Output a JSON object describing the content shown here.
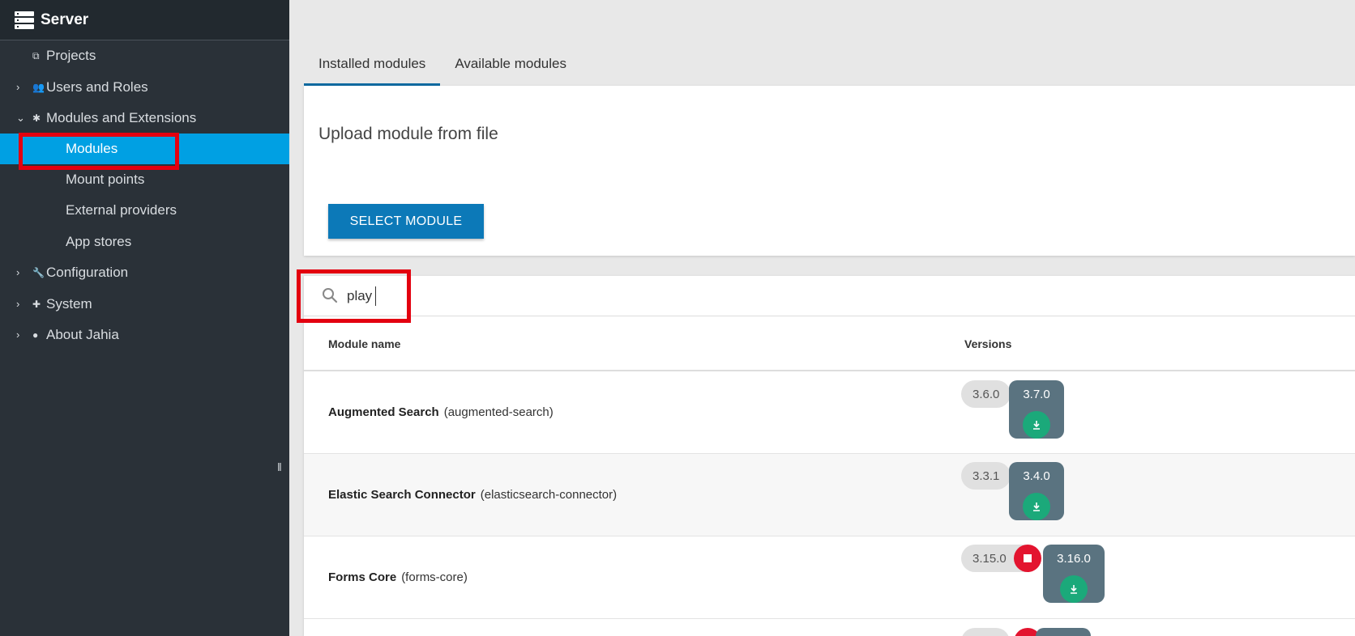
{
  "sidebar": {
    "title": "Server",
    "items": [
      {
        "label": "Projects",
        "icon": "projects-icon",
        "chevron": ""
      },
      {
        "label": "Users and Roles",
        "icon": "users-icon",
        "chevron": "right"
      },
      {
        "label": "Modules and Extensions",
        "icon": "puzzle-icon",
        "chevron": "down"
      },
      {
        "label": "Configuration",
        "icon": "wrench-icon",
        "chevron": "right"
      },
      {
        "label": "System",
        "icon": "plus-icon",
        "chevron": "right"
      },
      {
        "label": "About Jahia",
        "icon": "info-icon",
        "chevron": "right"
      }
    ],
    "subitems": [
      {
        "label": "Modules",
        "active": true
      },
      {
        "label": "Mount points"
      },
      {
        "label": "External providers"
      },
      {
        "label": "App stores"
      }
    ]
  },
  "tabs": [
    {
      "label": "Installed modules",
      "active": true
    },
    {
      "label": "Available modules"
    }
  ],
  "upload": {
    "title": "Upload module from file",
    "button_label": "SELECT MODULE"
  },
  "search": {
    "value": "play"
  },
  "table": {
    "col_name": "Module name",
    "col_versions": "Versions",
    "rows": [
      {
        "name": "Augmented Search",
        "id": "(augmented-search)",
        "installed": "3.6.0",
        "available": "3.7.0",
        "running": false
      },
      {
        "name": "Elastic Search Connector",
        "id": "(elasticsearch-connector)",
        "installed": "3.3.1",
        "available": "3.4.0",
        "running": false
      },
      {
        "name": "Forms Core",
        "id": "(forms-core)",
        "installed": "3.15.0",
        "available": "3.16.0",
        "running": true
      }
    ]
  },
  "colors": {
    "sidebar_bg": "#2a3138",
    "active_item": "#00a0e3",
    "primary_button": "#0c79b8",
    "download": "#1ba97a",
    "stop": "#e3142f",
    "highlight": "#e3000f"
  }
}
